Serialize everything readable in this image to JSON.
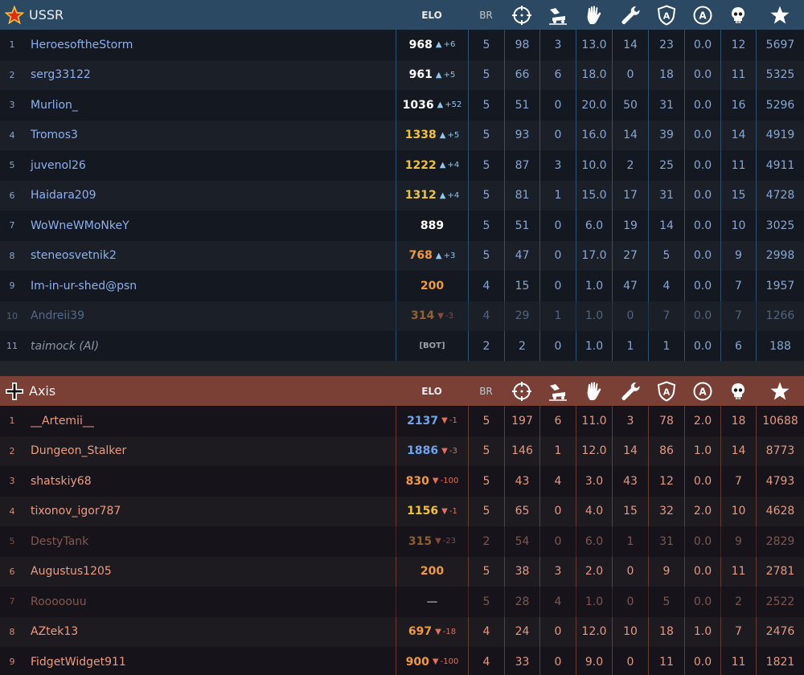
{
  "columns": {
    "elo": "ELO",
    "br": "BR",
    "icons": [
      "kills-crosshair-icon",
      "ground-kills-icon",
      "assists-hand-icon",
      "repairs-wrench-icon",
      "captures-shield-icon",
      "ai-kills-icon",
      "deaths-skull-icon",
      "score-star-icon"
    ]
  },
  "colors": {
    "ussr_header": "#2b4963",
    "axis_header": "#7a4036",
    "elo_white": "#ffffff",
    "elo_yellow": "#f2c33a",
    "elo_orange": "#f09a3c",
    "elo_blue": "#6ea4f0"
  },
  "teams": [
    {
      "name": "USSR",
      "emblem": "star-emblem-icon",
      "players": [
        {
          "n": "1",
          "name": "HeroesoftheStorm",
          "elo": "968",
          "dir": "up",
          "delta": "+6",
          "elo_color": "#ffffff",
          "br": "5",
          "k": "98",
          "g": "3",
          "a": "13.0",
          "r": "14",
          "c": "23",
          "aa": "0.0",
          "d": "12",
          "s": "5697"
        },
        {
          "n": "2",
          "name": "serg33122",
          "elo": "961",
          "dir": "up",
          "delta": "+5",
          "elo_color": "#ffffff",
          "br": "5",
          "k": "66",
          "g": "6",
          "a": "18.0",
          "r": "0",
          "c": "18",
          "aa": "0.0",
          "d": "11",
          "s": "5325"
        },
        {
          "n": "3",
          "name": "Murlion_",
          "elo": "1036",
          "dir": "up",
          "delta": "+52",
          "elo_color": "#ffffff",
          "br": "5",
          "k": "51",
          "g": "0",
          "a": "20.0",
          "r": "50",
          "c": "31",
          "aa": "0.0",
          "d": "16",
          "s": "5296"
        },
        {
          "n": "4",
          "name": "Tromos3",
          "elo": "1338",
          "dir": "up",
          "delta": "+5",
          "elo_color": "#f2c33a",
          "br": "5",
          "k": "93",
          "g": "0",
          "a": "16.0",
          "r": "14",
          "c": "39",
          "aa": "0.0",
          "d": "14",
          "s": "4919"
        },
        {
          "n": "5",
          "name": "juvenol26",
          "elo": "1222",
          "dir": "up",
          "delta": "+4",
          "elo_color": "#f2c33a",
          "br": "5",
          "k": "87",
          "g": "3",
          "a": "10.0",
          "r": "2",
          "c": "25",
          "aa": "0.0",
          "d": "11",
          "s": "4911"
        },
        {
          "n": "6",
          "name": "Haidara209",
          "elo": "1312",
          "dir": "up",
          "delta": "+4",
          "elo_color": "#f2c33a",
          "br": "5",
          "k": "81",
          "g": "1",
          "a": "15.0",
          "r": "17",
          "c": "31",
          "aa": "0.0",
          "d": "15",
          "s": "4728"
        },
        {
          "n": "7",
          "name": "WoWneWMoNkeY",
          "elo": "889",
          "dir": "",
          "delta": "",
          "elo_color": "#ffffff",
          "br": "5",
          "k": "51",
          "g": "0",
          "a": "6.0",
          "r": "19",
          "c": "14",
          "aa": "0.0",
          "d": "10",
          "s": "3025"
        },
        {
          "n": "8",
          "name": "steneosvetnik2",
          "elo": "768",
          "dir": "up",
          "delta": "+3",
          "elo_color": "#f09a3c",
          "br": "5",
          "k": "47",
          "g": "0",
          "a": "17.0",
          "r": "27",
          "c": "5",
          "aa": "0.0",
          "d": "9",
          "s": "2998"
        },
        {
          "n": "9",
          "name": "Im-in-ur-shed@psn",
          "elo": "200",
          "dir": "",
          "delta": "",
          "elo_color": "#f09a3c",
          "br": "4",
          "k": "15",
          "g": "0",
          "a": "1.0",
          "r": "47",
          "c": "4",
          "aa": "0.0",
          "d": "7",
          "s": "1957"
        },
        {
          "n": "10",
          "name": "Andreii39",
          "elo": "314",
          "dir": "down",
          "delta": "-3",
          "elo_color": "#f09a3c",
          "dim": true,
          "br": "4",
          "k": "29",
          "g": "1",
          "a": "1.0",
          "r": "0",
          "c": "7",
          "aa": "0.0",
          "d": "7",
          "s": "1266"
        },
        {
          "n": "11",
          "name": "taimock (AI)",
          "elo": "[BOT]",
          "bot": true,
          "dir": "",
          "delta": "",
          "elo_color": "#9aa3ad",
          "br": "2",
          "k": "2",
          "g": "0",
          "a": "1.0",
          "r": "1",
          "c": "1",
          "aa": "0.0",
          "d": "6",
          "s": "188"
        }
      ]
    },
    {
      "name": "Axis",
      "emblem": "balkenkreuz-emblem-icon",
      "players": [
        {
          "n": "1",
          "name": "__Artemii__",
          "elo": "2137",
          "dir": "down",
          "delta": "-1",
          "elo_color": "#6ea4f0",
          "br": "5",
          "k": "197",
          "g": "6",
          "a": "11.0",
          "r": "3",
          "c": "78",
          "aa": "2.0",
          "d": "18",
          "s": "10688"
        },
        {
          "n": "2",
          "name": "Dungeon_Stalker",
          "elo": "1886",
          "dir": "down",
          "delta": "-3",
          "elo_color": "#6ea4f0",
          "br": "5",
          "k": "146",
          "g": "1",
          "a": "12.0",
          "r": "14",
          "c": "86",
          "aa": "1.0",
          "d": "14",
          "s": "8773"
        },
        {
          "n": "3",
          "name": "shatskiy68",
          "elo": "830",
          "dir": "down",
          "delta": "-100",
          "elo_color": "#f09a3c",
          "br": "5",
          "k": "43",
          "g": "4",
          "a": "3.0",
          "r": "43",
          "c": "12",
          "aa": "0.0",
          "d": "7",
          "s": "4793"
        },
        {
          "n": "4",
          "name": "tixonov_igor787",
          "elo": "1156",
          "dir": "down",
          "delta": "-1",
          "elo_color": "#f2c33a",
          "br": "5",
          "k": "65",
          "g": "0",
          "a": "4.0",
          "r": "15",
          "c": "32",
          "aa": "2.0",
          "d": "10",
          "s": "4628"
        },
        {
          "n": "5",
          "name": "DestyTank",
          "elo": "315",
          "dir": "down",
          "delta": "-23",
          "elo_color": "#f09a3c",
          "dim": true,
          "br": "2",
          "k": "54",
          "g": "0",
          "a": "6.0",
          "r": "1",
          "c": "31",
          "aa": "0.0",
          "d": "9",
          "s": "2829"
        },
        {
          "n": "6",
          "name": "Augustus1205",
          "elo": "200",
          "dir": "",
          "delta": "",
          "elo_color": "#f09a3c",
          "br": "5",
          "k": "38",
          "g": "3",
          "a": "2.0",
          "r": "0",
          "c": "9",
          "aa": "0.0",
          "d": "11",
          "s": "2781"
        },
        {
          "n": "7",
          "name": "Rooooouu",
          "elo": "—",
          "dir": "",
          "delta": "",
          "elo_color": "#cfd6dc",
          "dim": true,
          "br": "5",
          "k": "28",
          "g": "4",
          "a": "1.0",
          "r": "0",
          "c": "5",
          "aa": "0.0",
          "d": "2",
          "s": "2522"
        },
        {
          "n": "8",
          "name": "AZtek13",
          "elo": "697",
          "dir": "down",
          "delta": "-18",
          "elo_color": "#f09a3c",
          "br": "4",
          "k": "24",
          "g": "0",
          "a": "12.0",
          "r": "10",
          "c": "18",
          "aa": "1.0",
          "d": "7",
          "s": "2476"
        },
        {
          "n": "9",
          "name": "FidgetWidget911",
          "elo": "900",
          "dir": "down",
          "delta": "-100",
          "elo_color": "#f09a3c",
          "br": "4",
          "k": "33",
          "g": "0",
          "a": "9.0",
          "r": "0",
          "c": "11",
          "aa": "0.0",
          "d": "11",
          "s": "1821"
        }
      ]
    }
  ]
}
